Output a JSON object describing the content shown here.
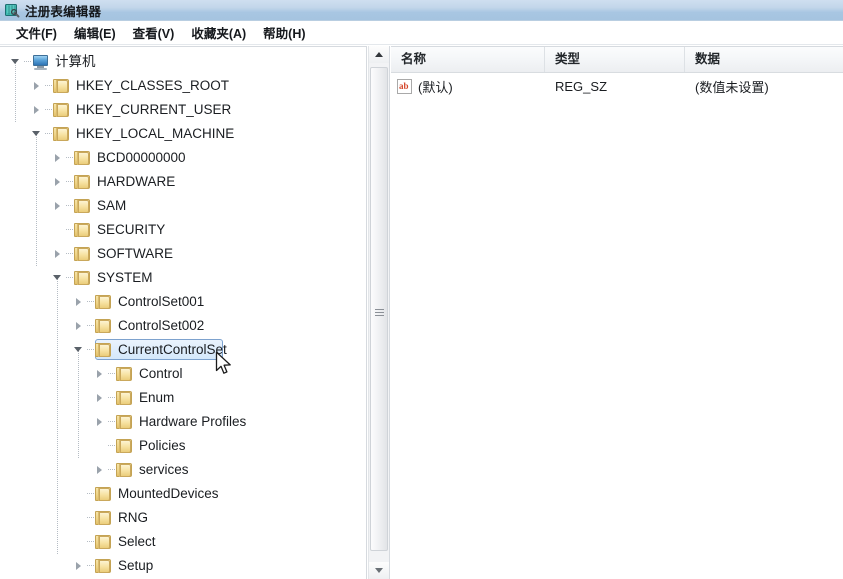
{
  "window": {
    "title": "注册表编辑器",
    "icon": "registry-editor-icon"
  },
  "menubar": {
    "items": [
      {
        "label": "文件(F)",
        "name": "menu-file"
      },
      {
        "label": "编辑(E)",
        "name": "menu-edit"
      },
      {
        "label": "查看(V)",
        "name": "menu-view"
      },
      {
        "label": "收藏夹(A)",
        "name": "menu-favorites"
      },
      {
        "label": "帮助(H)",
        "name": "menu-help"
      }
    ]
  },
  "tree": {
    "root_label": "计算机",
    "nodes": [
      {
        "label": "计算机",
        "depth": 0,
        "state": "expanded",
        "icon": "computer-icon"
      },
      {
        "label": "HKEY_CLASSES_ROOT",
        "depth": 1,
        "state": "collapsed",
        "icon": "folder-icon"
      },
      {
        "label": "HKEY_CURRENT_USER",
        "depth": 1,
        "state": "collapsed",
        "icon": "folder-icon"
      },
      {
        "label": "HKEY_LOCAL_MACHINE",
        "depth": 1,
        "state": "expanded",
        "icon": "folder-icon"
      },
      {
        "label": "BCD00000000",
        "depth": 2,
        "state": "collapsed",
        "icon": "folder-icon"
      },
      {
        "label": "HARDWARE",
        "depth": 2,
        "state": "collapsed",
        "icon": "folder-icon"
      },
      {
        "label": "SAM",
        "depth": 2,
        "state": "collapsed",
        "icon": "folder-icon"
      },
      {
        "label": "SECURITY",
        "depth": 2,
        "state": "leaf",
        "icon": "folder-icon"
      },
      {
        "label": "SOFTWARE",
        "depth": 2,
        "state": "collapsed",
        "icon": "folder-icon"
      },
      {
        "label": "SYSTEM",
        "depth": 2,
        "state": "expanded",
        "icon": "folder-icon"
      },
      {
        "label": "ControlSet001",
        "depth": 3,
        "state": "collapsed",
        "icon": "folder-icon"
      },
      {
        "label": "ControlSet002",
        "depth": 3,
        "state": "collapsed",
        "icon": "folder-icon"
      },
      {
        "label": "CurrentControlSet",
        "depth": 3,
        "state": "expanded",
        "icon": "folder-icon",
        "selected": true
      },
      {
        "label": "Control",
        "depth": 4,
        "state": "collapsed",
        "icon": "folder-icon"
      },
      {
        "label": "Enum",
        "depth": 4,
        "state": "collapsed",
        "icon": "folder-icon"
      },
      {
        "label": "Hardware Profiles",
        "depth": 4,
        "state": "collapsed",
        "icon": "folder-icon"
      },
      {
        "label": "Policies",
        "depth": 4,
        "state": "leaf",
        "icon": "folder-icon"
      },
      {
        "label": "services",
        "depth": 4,
        "state": "collapsed",
        "icon": "folder-icon"
      },
      {
        "label": "MountedDevices",
        "depth": 3,
        "state": "leaf",
        "icon": "folder-icon"
      },
      {
        "label": "RNG",
        "depth": 3,
        "state": "leaf",
        "icon": "folder-icon"
      },
      {
        "label": "Select",
        "depth": 3,
        "state": "leaf",
        "icon": "folder-icon"
      },
      {
        "label": "Setup",
        "depth": 3,
        "state": "collapsed",
        "icon": "folder-icon"
      }
    ]
  },
  "listview": {
    "columns": [
      {
        "label": "名称",
        "name": "column-name"
      },
      {
        "label": "类型",
        "name": "column-type"
      },
      {
        "label": "数据",
        "name": "column-data"
      }
    ],
    "rows": [
      {
        "icon": "string-value-icon",
        "icon_text": "ab",
        "name": "(默认)",
        "type": "REG_SZ",
        "data": "(数值未设置)"
      }
    ]
  },
  "scrollbar": {
    "up_arrow": "scroll-up-arrow",
    "down_arrow": "scroll-down-arrow",
    "thumb": "scroll-thumb"
  },
  "colors": {
    "titlebar_start": "#cfdff0",
    "titlebar_end": "#a5c4e0",
    "selection_fill": "#d4e8fb",
    "selection_border": "#7da2ce",
    "folder_gold": "#efd488",
    "ab_red": "#d4462a"
  }
}
